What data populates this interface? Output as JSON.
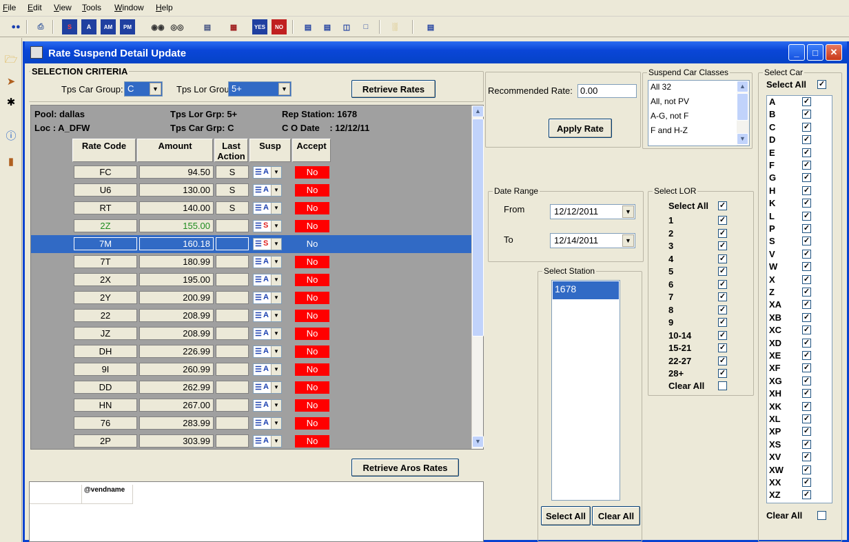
{
  "menu": [
    "File",
    "Edit",
    "View",
    "Tools",
    "Window",
    "Help"
  ],
  "window": {
    "title": "Rate Suspend Detail Update"
  },
  "selection": {
    "legend": "SELECTION CRITERIA",
    "car_group_label": "Tps Car Group:",
    "car_group_value": "C",
    "lor_group_label": "Tps Lor Group",
    "lor_group_value": "5+",
    "retrieve_label": "Retrieve Rates"
  },
  "info": {
    "pool": "Pool: dallas",
    "loc": "Loc : A_DFW",
    "lor_grp": "Tps Lor Grp: 5+",
    "car_grp": "Tps Car Grp: C",
    "rep_station": "Rep Station: 1678",
    "co_date": "C O Date    : 12/12/11"
  },
  "columns": {
    "rate_code": "Rate Code",
    "amount": "Amount",
    "last_action": "Last Action",
    "susp": "Susp",
    "accept": "Accept"
  },
  "rows": [
    {
      "code": "FC",
      "amount": "94.50",
      "action": "S",
      "susp": "A",
      "accept": "No"
    },
    {
      "code": "U6",
      "amount": "130.00",
      "action": "S",
      "susp": "A",
      "accept": "No"
    },
    {
      "code": "RT",
      "amount": "140.00",
      "action": "S",
      "susp": "A",
      "accept": "No"
    },
    {
      "code": "2Z",
      "amount": "155.00",
      "action": "",
      "susp": "S",
      "accept": "No"
    },
    {
      "code": "7M",
      "amount": "160.18",
      "action": "",
      "susp": "S",
      "accept": "No"
    },
    {
      "code": "7T",
      "amount": "180.99",
      "action": "",
      "susp": "A",
      "accept": "No"
    },
    {
      "code": "2X",
      "amount": "195.00",
      "action": "",
      "susp": "A",
      "accept": "No"
    },
    {
      "code": "2Y",
      "amount": "200.99",
      "action": "",
      "susp": "A",
      "accept": "No"
    },
    {
      "code": "22",
      "amount": "208.99",
      "action": "",
      "susp": "A",
      "accept": "No"
    },
    {
      "code": "JZ",
      "amount": "208.99",
      "action": "",
      "susp": "A",
      "accept": "No"
    },
    {
      "code": "DH",
      "amount": "226.99",
      "action": "",
      "susp": "A",
      "accept": "No"
    },
    {
      "code": "9I",
      "amount": "260.99",
      "action": "",
      "susp": "A",
      "accept": "No"
    },
    {
      "code": "DD",
      "amount": "262.99",
      "action": "",
      "susp": "A",
      "accept": "No"
    },
    {
      "code": "HN",
      "amount": "267.00",
      "action": "",
      "susp": "A",
      "accept": "No"
    },
    {
      "code": "76",
      "amount": "283.99",
      "action": "",
      "susp": "A",
      "accept": "No"
    },
    {
      "code": "2P",
      "amount": "303.99",
      "action": "",
      "susp": "A",
      "accept": "No"
    }
  ],
  "retrieve_aros_label": "Retrieve Aros Rates",
  "vend_header": "@vendname",
  "recommended": {
    "label": "Recommended Rate:",
    "value": "0.00",
    "apply_label": "Apply Rate"
  },
  "suspend_classes": {
    "legend": "Suspend Car Classes",
    "items": [
      "All 32",
      "All, not PV",
      "A-G, not F",
      "F and H-Z"
    ]
  },
  "date_range": {
    "legend": "Date Range",
    "from_label": "From",
    "from_value": "12/12/2011",
    "to_label": "To",
    "to_value": "12/14/2011"
  },
  "station": {
    "legend": "Select Station",
    "items": [
      "1678"
    ],
    "select_all": "Select All",
    "clear_all": "Clear All"
  },
  "lor": {
    "legend": "Select LOR",
    "select_all": "Select All",
    "items": [
      "1",
      "2",
      "3",
      "4",
      "5",
      "6",
      "7",
      "8",
      "9",
      "10-14",
      "15-21",
      "22-27",
      "28+"
    ],
    "clear_all": "Clear All"
  },
  "car": {
    "legend": "Select Car",
    "select_all": "Select All",
    "items": [
      "A",
      "B",
      "C",
      "D",
      "E",
      "F",
      "G",
      "H",
      "K",
      "L",
      "P",
      "S",
      "V",
      "W",
      "X",
      "Z",
      "XA",
      "XB",
      "XC",
      "XD",
      "XE",
      "XF",
      "XG",
      "XH",
      "XK",
      "XL",
      "XP",
      "XS",
      "XV",
      "XW",
      "XX",
      "XZ"
    ],
    "clear_all": "Clear All"
  },
  "colors": {
    "selected_row": "#316ac5",
    "accept_no": "#ff0000",
    "green_text": "#1e8c1e"
  }
}
